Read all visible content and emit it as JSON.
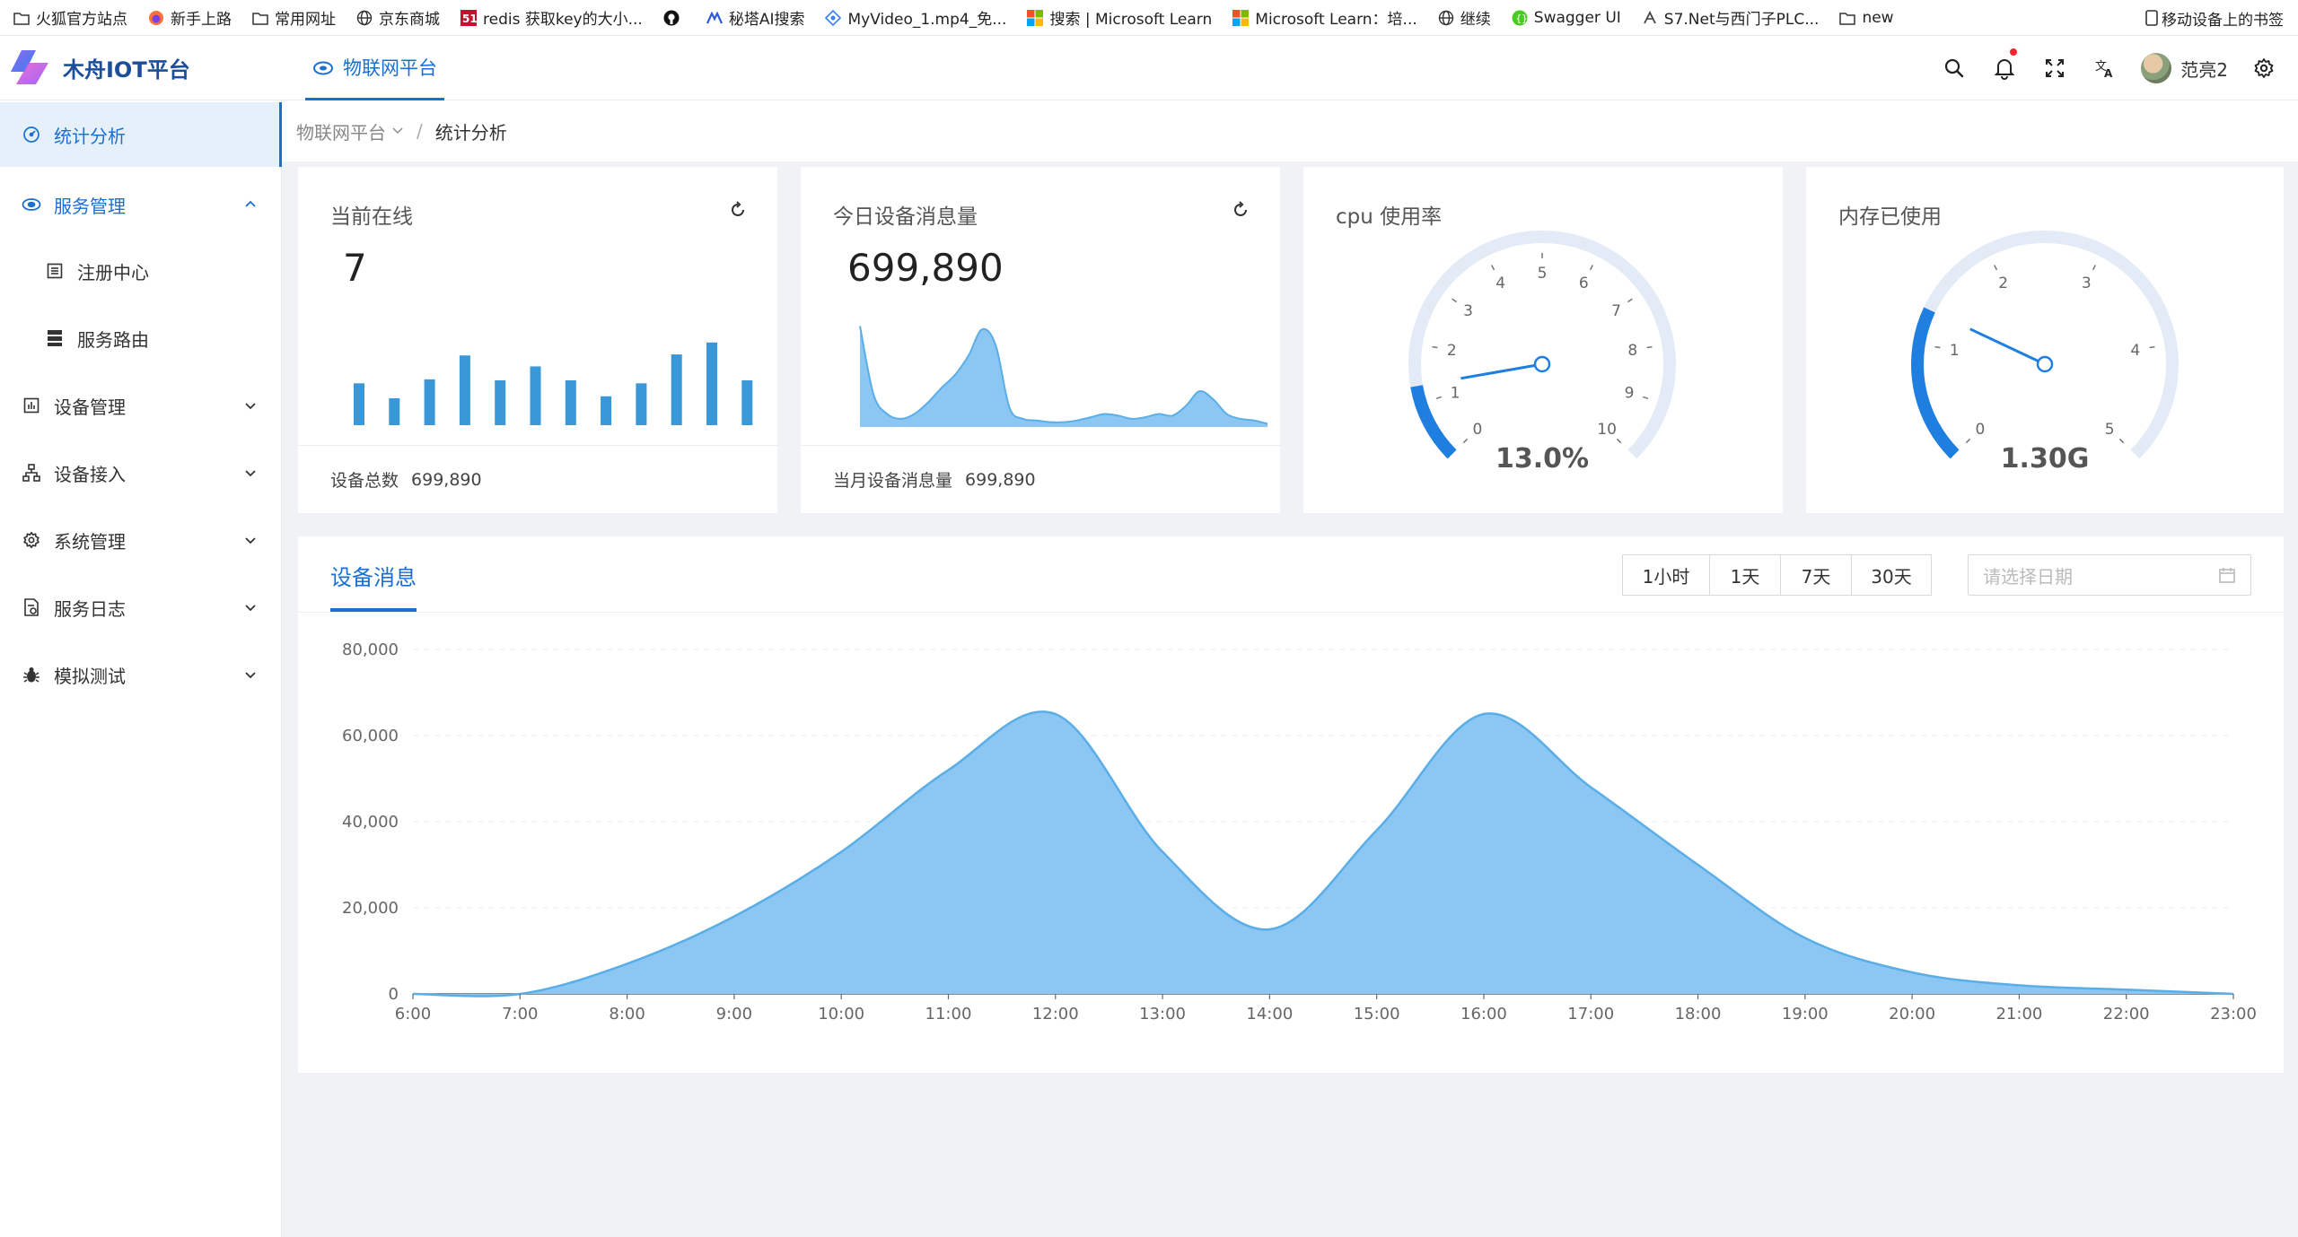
{
  "bookmarks": {
    "items": [
      {
        "label": "火狐官方站点",
        "icon": "folder-icon"
      },
      {
        "label": "新手上路",
        "icon": "firefox-icon"
      },
      {
        "label": "常用网址",
        "icon": "folder-icon"
      },
      {
        "label": "京东商城",
        "icon": "globe-icon"
      },
      {
        "label": "redis 获取key的大小...",
        "icon": "site-51-icon"
      },
      {
        "label": "",
        "icon": "github-icon"
      },
      {
        "label": "秘塔AI搜索",
        "icon": "metaso-icon"
      },
      {
        "label": "MyVideo_1.mp4_免...",
        "icon": "video-icon"
      },
      {
        "label": "搜索 | Microsoft Learn",
        "icon": "microsoft-icon"
      },
      {
        "label": "Microsoft Learn：培...",
        "icon": "microsoft-icon"
      },
      {
        "label": "继续",
        "icon": "globe-icon"
      },
      {
        "label": "Swagger UI",
        "icon": "swagger-icon"
      },
      {
        "label": "S7.Net与西门子PLC...",
        "icon": "s7-icon"
      },
      {
        "label": "new",
        "icon": "folder-icon"
      }
    ],
    "mobile": "移动设备上的书签"
  },
  "header": {
    "app_name": "木舟IOT平台",
    "active_tab": "物联网平台",
    "username": "范亮2"
  },
  "sidebar": {
    "items": [
      {
        "label": "统计分析",
        "icon": "dashboard-icon",
        "state": "active"
      },
      {
        "label": "服务管理",
        "icon": "cloud-icon",
        "state": "open",
        "chevron": "up"
      },
      {
        "label": "注册中心",
        "icon": "list-icon",
        "state": "sub"
      },
      {
        "label": "服务路由",
        "icon": "server-icon",
        "state": "sub"
      },
      {
        "label": "设备管理",
        "icon": "chart-icon",
        "state": "closed",
        "chevron": "down"
      },
      {
        "label": "设备接入",
        "icon": "network-icon",
        "state": "closed",
        "chevron": "down"
      },
      {
        "label": "系统管理",
        "icon": "gear-icon",
        "state": "closed",
        "chevron": "down"
      },
      {
        "label": "服务日志",
        "icon": "log-icon",
        "state": "closed",
        "chevron": "down"
      },
      {
        "label": "模拟测试",
        "icon": "bug-icon",
        "state": "closed",
        "chevron": "down"
      }
    ]
  },
  "breadcrumb": {
    "root": "物联网平台",
    "separator": "/",
    "current": "统计分析"
  },
  "cards": {
    "online": {
      "title": "当前在线",
      "value": "7",
      "footer_label": "设备总数",
      "footer_value": "699,890"
    },
    "messages_today": {
      "title": "今日设备消息量",
      "value": "699,890",
      "footer_label": "当月设备消息量",
      "footer_value": "699,890"
    },
    "cpu": {
      "title": "cpu 使用率",
      "value_label": "13.0%"
    },
    "memory": {
      "title": "内存已使用",
      "value_label": "1.30G"
    }
  },
  "panel": {
    "tab": "设备消息",
    "range_buttons": [
      "1小时",
      "1天",
      "7天",
      "30天"
    ],
    "date_placeholder": "请选择日期"
  },
  "colors": {
    "primary": "#1a6fd0",
    "bar": "#3a98d8",
    "area_fill": "#8cc6f2",
    "area_line": "#5aaee8",
    "gauge_track": "#e3ebf6",
    "gauge_active": "#1e7fe0"
  },
  "chart_data": [
    {
      "type": "bar",
      "categories": [
        "1",
        "2",
        "3",
        "4",
        "5",
        "6",
        "7",
        "8",
        "9",
        "10",
        "11",
        "12"
      ],
      "values": [
        42,
        27,
        46,
        70,
        45,
        59,
        45,
        29,
        42,
        71,
        83,
        45
      ],
      "ylim": [
        0,
        90
      ]
    },
    {
      "type": "area",
      "x": [
        0,
        1,
        2,
        3,
        4,
        5,
        6,
        7,
        8,
        9,
        10,
        11,
        12,
        13,
        14,
        15,
        16,
        17,
        18,
        19,
        20,
        21,
        22,
        23,
        24,
        25,
        26,
        27,
        28,
        29,
        30
      ],
      "values": [
        62,
        20,
        8,
        5,
        8,
        15,
        24,
        32,
        44,
        60,
        50,
        12,
        5,
        4,
        3,
        3,
        4,
        6,
        8,
        7,
        5,
        6,
        8,
        7,
        13,
        22,
        17,
        8,
        5,
        4,
        2
      ],
      "ylim": [
        0,
        65
      ]
    },
    {
      "type": "gauge",
      "title": "cpu 使用率",
      "min": 0,
      "max": 10,
      "ticks": [
        "0",
        "1",
        "2",
        "3",
        "4",
        "5",
        "6",
        "7",
        "8",
        "9",
        "10"
      ],
      "value": 1.3,
      "value_label": "13.0%"
    },
    {
      "type": "gauge",
      "title": "内存已使用",
      "min": 0,
      "max": 5,
      "ticks": [
        "0",
        "1",
        "2",
        "3",
        "4",
        "5"
      ],
      "value": 1.3,
      "value_label": "1.30G"
    },
    {
      "type": "area",
      "title": "设备消息",
      "x": [
        "6:00",
        "7:00",
        "8:00",
        "9:00",
        "10:00",
        "11:00",
        "12:00",
        "13:00",
        "14:00",
        "15:00",
        "16:00",
        "17:00",
        "18:00",
        "19:00",
        "20:00",
        "21:00",
        "22:00",
        "23:00"
      ],
      "values": [
        0,
        0,
        7000,
        18000,
        33000,
        52000,
        65000,
        33000,
        15000,
        38000,
        65000,
        48000,
        30000,
        13000,
        5000,
        2000,
        1000,
        0
      ],
      "yticks": [
        0,
        20000,
        40000,
        60000,
        80000
      ],
      "ytick_labels": [
        "0",
        "20,000",
        "40,000",
        "60,000",
        "80,000"
      ],
      "ylim": [
        0,
        80000
      ]
    }
  ]
}
